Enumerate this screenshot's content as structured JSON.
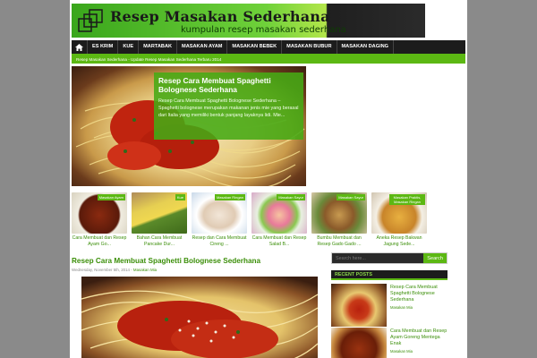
{
  "site": {
    "title": "Resep Masakan Sederhana",
    "subtitle": "kumpulan resep masakan sederhana"
  },
  "nav": {
    "items": [
      {
        "label": "ES KRIM"
      },
      {
        "label": "KUE"
      },
      {
        "label": "MARTABAK"
      },
      {
        "label": "MASAKAN AYAM"
      },
      {
        "label": "MASAKAN BEBEK"
      },
      {
        "label": "MASAKAN BUBUR"
      },
      {
        "label": "MASAKAN DAGING"
      }
    ]
  },
  "ticker": "Resep Masakan Sederhana - Update Resep Masakan Sederhana Terbaru 2014",
  "slider": {
    "title": "Resep Cara Membuat Spaghetti Bolognese Sederhana",
    "excerpt": "Resep Cara Membuat Spaghetti Bolognese Sederhana – Spaghetti bolognese merupakan makanan jenis mie yang berasal dari Italia yang memiliki bentuk panjang layaknya lidi. Mie..."
  },
  "thumbs": [
    {
      "tag": "Masakan Ayam",
      "title": "Cara Membuat dan Resep Ayam Go...",
      "color": "#7a2a12"
    },
    {
      "tag": "Kue",
      "title": "Bahan Cara Membuat Pancake Dur...",
      "color": "#d8c040"
    },
    {
      "tag": "Masakan Ringan",
      "title": "Resep dan Cara Membuat Cireng ...",
      "color": "#e8d8c8"
    },
    {
      "tag": "Masakan Sayur",
      "title": "Cara Membuat dan Resep Salad B...",
      "color": "#e87a9a"
    },
    {
      "tag": "Masakan Sayur",
      "title": "Bumbu Membuat dan Resep Gado Gado ...",
      "color": "#a87a3a"
    },
    {
      "tag": "Masakan Praktis, Masakan Ringan",
      "title": "Aneka Resep Bakwan Jagung Sede...",
      "color": "#d89a3a"
    }
  ],
  "post": {
    "title": "Resep Cara Membuat Spaghetti Bolognese Sederhana",
    "date": "Wednesday, November 5th, 2014 -",
    "author": "Masakan Mia"
  },
  "sidebar": {
    "search_placeholder": "Search here...",
    "search_button": "Search",
    "recent_heading": "RECENT POSTS",
    "recent": [
      {
        "title": "Resep Cara Membuat Spaghetti Bolognese Sederhana",
        "author": "Masakan Mia"
      },
      {
        "title": "Cara Membuat dan Resep Ayam Goreng Mentega Enak",
        "author": "Masakan Mia"
      }
    ]
  }
}
